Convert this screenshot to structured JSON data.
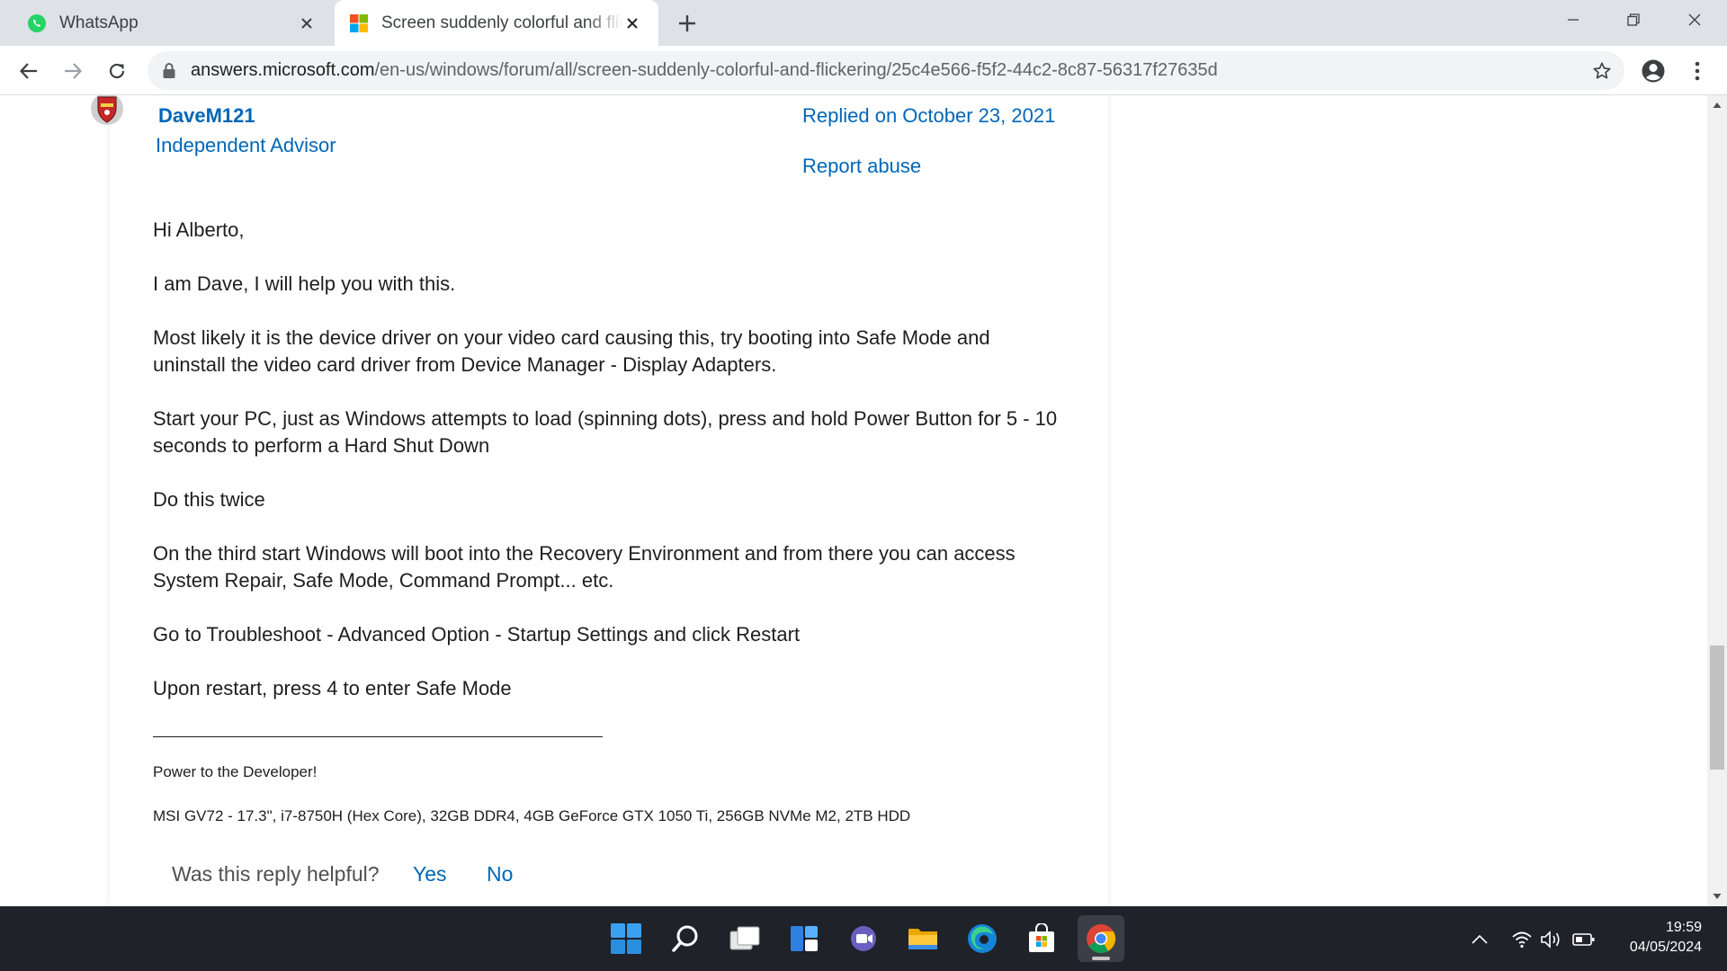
{
  "browser": {
    "tabs": [
      {
        "title": "WhatsApp",
        "active": false,
        "icon": "whatsapp-icon"
      },
      {
        "title": "Screen suddenly colorful and flickering",
        "active": true,
        "icon": "microsoft-icon"
      }
    ],
    "url": {
      "host": "answers.microsoft.com",
      "path": "/en-us/windows/forum/all/screen-suddenly-colorful-and-flickering/25c4e566-f5f2-44c2-8c87-56317f27635d"
    }
  },
  "reply": {
    "author": "DaveM121",
    "role": "Independent Advisor",
    "replied": "Replied on October 23, 2021",
    "report": "Report abuse",
    "paragraphs": {
      "greeting": "Hi Alberto,",
      "intro": "I am Dave, I will help you with this.",
      "driver": "Most likely it is the device driver on your video card causing this, try booting into Safe Mode and uninstall the video card driver from Device Manager - Display Adapters.",
      "start": "Start your PC, just as Windows attempts to load (spinning dots), press and hold Power Button for 5 - 10 seconds to perform a Hard Shut Down",
      "twice": "Do this twice",
      "third": "On the third start Windows will boot into the Recovery Environment and from there you can access System Repair, Safe Mode, Command Prompt... etc.",
      "troubleshoot": "Go to Troubleshoot - Advanced Option - Startup Settings and click Restart",
      "restart": "Upon restart, press 4 to enter Safe Mode"
    },
    "signature": {
      "motto": "Power to the Developer!",
      "specs": "MSI GV72 - 17.3\", i7-8750H (Hex Core), 32GB DDR4, 4GB GeForce GTX 1050 Ti, 256GB NVMe M2, 2TB HDD"
    },
    "helpful": {
      "question": "Was this reply helpful?",
      "yes": "Yes",
      "no": "No"
    }
  },
  "taskbar": {
    "apps": [
      "start-icon",
      "search-icon",
      "task-view-icon",
      "widgets-icon",
      "teams-chat-icon",
      "file-explorer-icon",
      "edge-icon",
      "store-icon",
      "chrome-icon"
    ],
    "active_app": "chrome-icon",
    "time": "19:59",
    "date": "04/05/2024"
  },
  "colors": {
    "link": "#0067b8",
    "tabstrip": "#dee1e6",
    "taskbar": "#1f2229"
  }
}
